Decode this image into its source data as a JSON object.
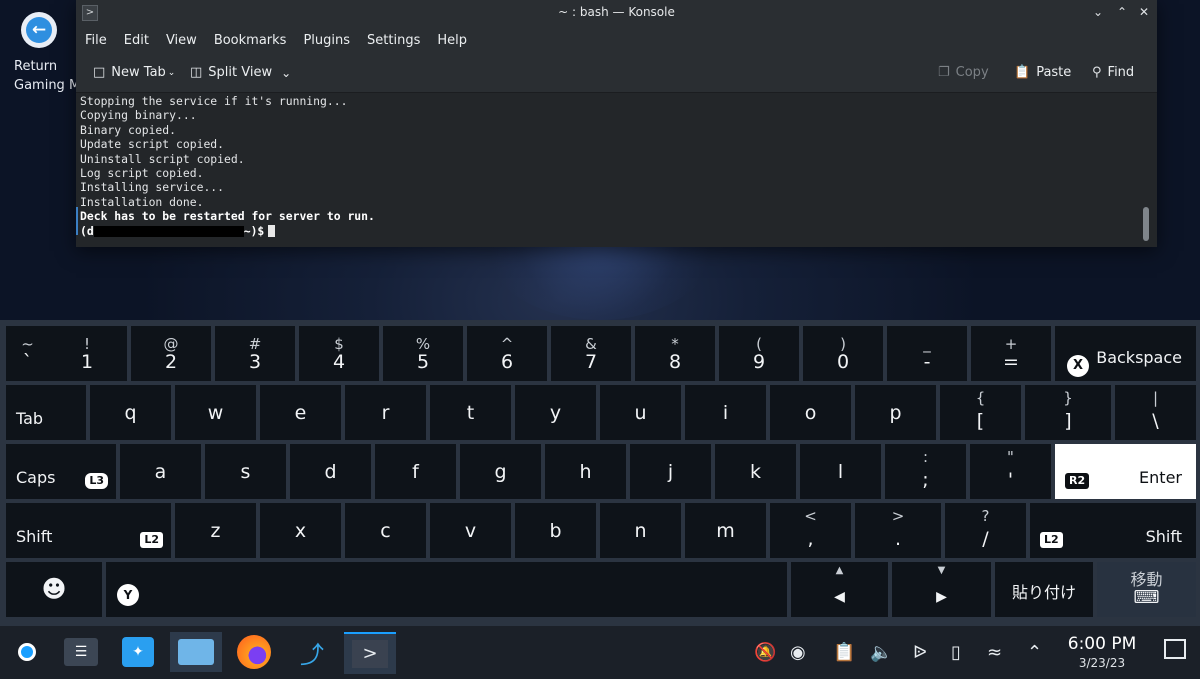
{
  "desktop": {
    "return_icon_label_1": "Return",
    "return_icon_label_2": "Gaming M"
  },
  "window": {
    "title": "~ : bash — Konsole",
    "menu": [
      "File",
      "Edit",
      "View",
      "Bookmarks",
      "Plugins",
      "Settings",
      "Help"
    ],
    "toolbar": {
      "new_tab": "New Tab",
      "split_view": "Split View",
      "copy": "Copy",
      "paste": "Paste",
      "find": "Find"
    },
    "terminal_lines": [
      "Stopping the service if it's running...",
      "Copying binary...",
      "Binary copied.",
      "Update script copied.",
      "Uninstall script copied.",
      "Log script copied.",
      "Installing service...",
      "Installation done."
    ],
    "terminal_bold_line": "Deck has to be restarted for server to run.",
    "prompt_start": "(d",
    "prompt_end": "~)$"
  },
  "keyboard": {
    "row1": [
      {
        "top": "~",
        "main": "`"
      },
      {
        "top": "!",
        "main": "1"
      },
      {
        "top": "@",
        "main": "2"
      },
      {
        "top": "#",
        "main": "3"
      },
      {
        "top": "$",
        "main": "4"
      },
      {
        "top": "%",
        "main": "5"
      },
      {
        "top": "^",
        "main": "6"
      },
      {
        "top": "&",
        "main": "7"
      },
      {
        "top": "*",
        "main": "8"
      },
      {
        "top": "(",
        "main": "9"
      },
      {
        "top": ")",
        "main": "0"
      },
      {
        "top": "_",
        "main": "-"
      },
      {
        "top": "+",
        "main": "="
      }
    ],
    "backspace": "Backspace",
    "backspace_btn": "X",
    "tab": "Tab",
    "row2": [
      "q",
      "w",
      "e",
      "r",
      "t",
      "y",
      "u",
      "i",
      "o",
      "p"
    ],
    "row2_sym": [
      {
        "top": "{",
        "main": "["
      },
      {
        "top": "}",
        "main": "]"
      },
      {
        "top": "|",
        "main": "\\"
      }
    ],
    "caps": "Caps",
    "caps_badge": "L3",
    "row3": [
      "a",
      "s",
      "d",
      "f",
      "g",
      "h",
      "j",
      "k",
      "l"
    ],
    "row3_sym": [
      {
        "top": ":",
        "main": ";"
      },
      {
        "top": "\"",
        "main": "'"
      }
    ],
    "enter": "Enter",
    "enter_badge": "R2",
    "shift": "Shift",
    "shift_badge": "L2",
    "row4": [
      "z",
      "x",
      "c",
      "v",
      "b",
      "n",
      "m"
    ],
    "row4_sym": [
      {
        "top": "<",
        "main": ","
      },
      {
        "top": ">",
        "main": "."
      },
      {
        "top": "?",
        "main": "/"
      }
    ],
    "space_btn": "Y",
    "paste_jp": "貼り付け",
    "move_jp": "移動"
  },
  "taskbar": {
    "time": "6:00 PM",
    "date": "3/23/23"
  }
}
